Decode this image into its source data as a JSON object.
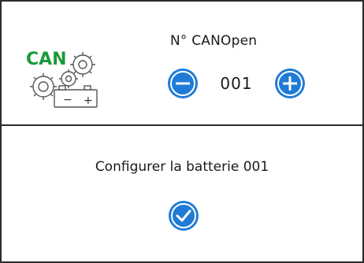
{
  "canopen": {
    "logo_text": "CAN",
    "logo_minus": "−",
    "logo_plus": "+",
    "node_label": "N° CANOpen",
    "node_value": "001",
    "decrement_icon": "minus-icon",
    "increment_icon": "plus-icon"
  },
  "battery": {
    "config_label": "Configurer la batterie 001",
    "confirm_icon": "checkmark-icon"
  },
  "colors": {
    "accent_blue": "#1f7bd6",
    "logo_green": "#1a9a3a",
    "border": "#2b2b2b",
    "text": "#1a1a1a"
  }
}
